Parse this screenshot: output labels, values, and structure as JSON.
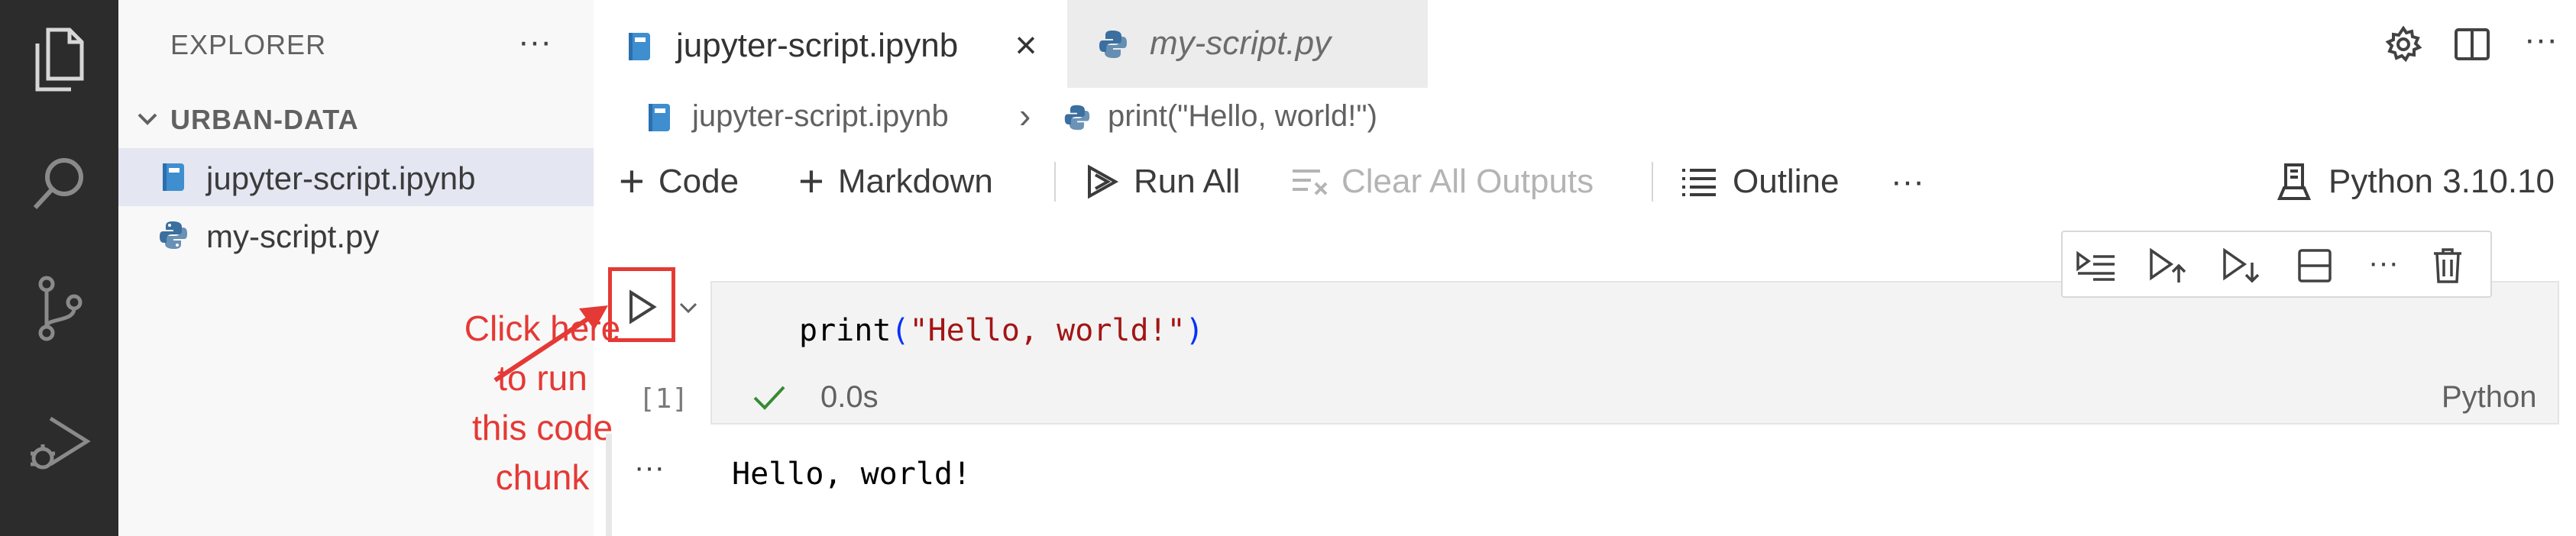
{
  "explorer": {
    "title": "EXPLORER",
    "more": "···",
    "folder": "URBAN-DATA",
    "files": [
      {
        "label": "jupyter-script.ipynb",
        "icon": "notebook-icon",
        "selected": true
      },
      {
        "label": "my-script.py",
        "icon": "python-icon",
        "selected": false
      }
    ]
  },
  "tabs": [
    {
      "label": "jupyter-script.ipynb",
      "icon": "notebook-icon",
      "active": true,
      "close": "×"
    },
    {
      "label": "my-script.py",
      "icon": "python-icon",
      "active": false
    }
  ],
  "breadcrumb": {
    "file": "jupyter-script.ipynb",
    "sep": "›",
    "symbol": "print(\"Hello, world!\")"
  },
  "toolbar": {
    "code": "Code",
    "markdown": "Markdown",
    "run_all": "Run All",
    "clear_outputs": "Clear All Outputs",
    "outline": "Outline",
    "more": "···",
    "kernel": "Python 3.10.10"
  },
  "cell": {
    "code_fn": "print",
    "code_open": "(",
    "code_str": "\"Hello, world!\"",
    "code_close": ")",
    "exec_count": "[1]",
    "duration": "0.0s",
    "language": "Python",
    "output_more": "···",
    "output": "Hello, world!"
  },
  "annotation": {
    "lines": [
      "Click here",
      "to run",
      "this code",
      "chunk"
    ]
  },
  "colors": {
    "activity_bar": "#2c2c2c",
    "explorer_bg": "#f8f8f8",
    "selection": "#e4e6f1",
    "annotation": "#e53935",
    "success": "#388a34"
  }
}
